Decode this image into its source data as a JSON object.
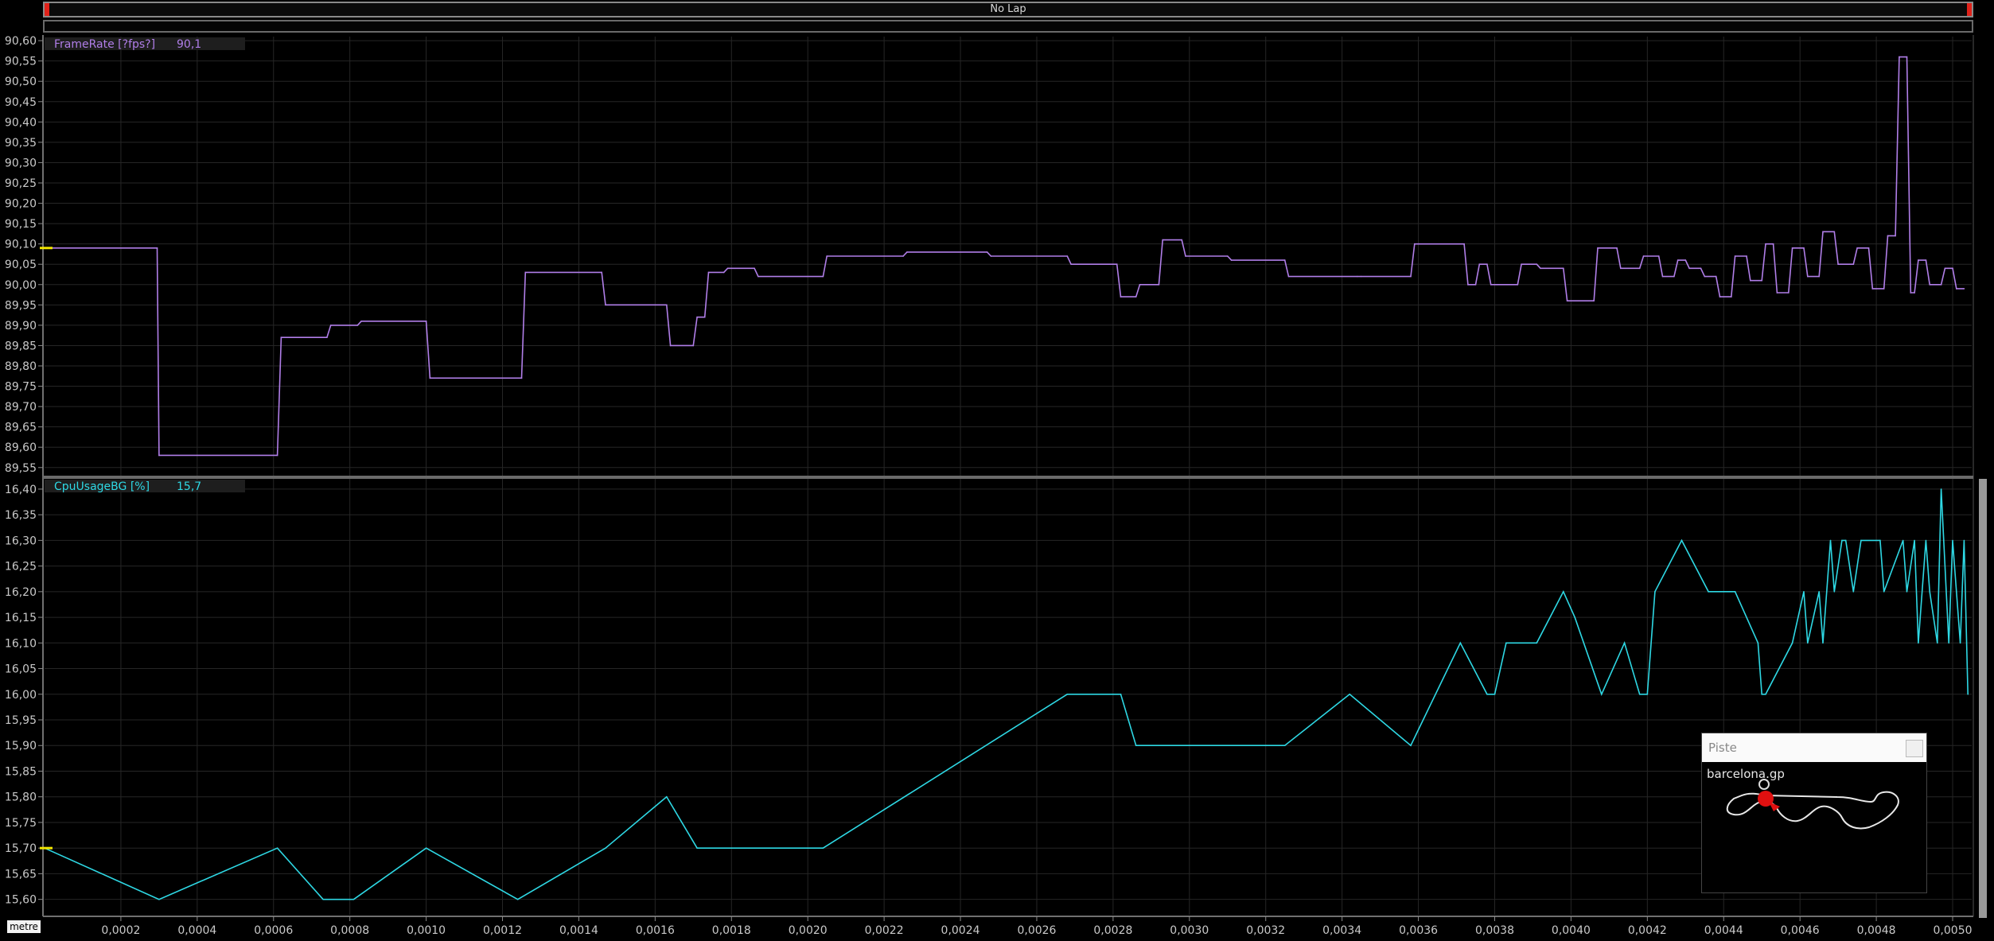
{
  "lap_bar": {
    "label": "No Lap"
  },
  "x_axis": {
    "unit": "metre",
    "range": [
      0,
      0.00505
    ],
    "ticks": [
      "0,0002",
      "0,0004",
      "0,0006",
      "0,0008",
      "0,0010",
      "0,0012",
      "0,0014",
      "0,0016",
      "0,0018",
      "0,0020",
      "0,0022",
      "0,0024",
      "0,0026",
      "0,0028",
      "0,0030",
      "0,0032",
      "0,0034",
      "0,0036",
      "0,0038",
      "0,0040",
      "0,0042",
      "0,0044",
      "0,0046",
      "0,0048",
      "0,0050"
    ]
  },
  "channels": [
    {
      "name": "FrameRate [?fps?]",
      "value": "90,1",
      "color": "#b07ee8",
      "y_ticks": [
        "90,60",
        "90,55",
        "90,50",
        "90,45",
        "90,40",
        "90,35",
        "90,30",
        "90,25",
        "90,20",
        "90,15",
        "90,10",
        "90,05",
        "90,00",
        "89,95",
        "89,90",
        "89,85",
        "89,80",
        "89,75",
        "89,70",
        "89,65",
        "89,60",
        "89,55"
      ]
    },
    {
      "name": "CpuUsageBG [%]",
      "value": "15,7",
      "color": "#2ed8e4",
      "y_ticks": [
        "16,40",
        "16,35",
        "16,30",
        "16,25",
        "16,20",
        "16,15",
        "16,10",
        "16,05",
        "16,00",
        "15,95",
        "15,90",
        "15,85",
        "15,80",
        "15,75",
        "15,70",
        "15,65",
        "15,60"
      ]
    }
  ],
  "chart_data": [
    {
      "type": "line",
      "series": [
        {
          "name": "FrameRate [?fps?]",
          "color": "#b07ee8",
          "x": [
            0,
            0.000295,
            0.0003,
            0.00061,
            0.00062,
            0.00074,
            0.00075,
            0.00082,
            0.00083,
            0.001,
            0.00101,
            0.00125,
            0.00126,
            0.00146,
            0.00147,
            0.00163,
            0.00164,
            0.0017,
            0.00171,
            0.00173,
            0.00174,
            0.00178,
            0.00179,
            0.00186,
            0.00187,
            0.00204,
            0.00205,
            0.00225,
            0.00226,
            0.00247,
            0.00248,
            0.00268,
            0.00269,
            0.00281,
            0.00282,
            0.00286,
            0.00287,
            0.00292,
            0.00293,
            0.00298,
            0.00299,
            0.0031,
            0.00311,
            0.00325,
            0.00326,
            0.00344,
            0.00345,
            0.00358,
            0.00359,
            0.00372,
            0.00373,
            0.00375,
            0.00376,
            0.00378,
            0.00379,
            0.00386,
            0.00387,
            0.00391,
            0.00392,
            0.00398,
            0.00399,
            0.00406,
            0.00407,
            0.00412,
            0.00413,
            0.00418,
            0.00419,
            0.00423,
            0.00424,
            0.00427,
            0.00428,
            0.0043,
            0.00431,
            0.00434,
            0.00435,
            0.00438,
            0.00439,
            0.00442,
            0.00443,
            0.00446,
            0.00447,
            0.0045,
            0.00451,
            0.00453,
            0.00454,
            0.00457,
            0.00458,
            0.00461,
            0.00462,
            0.00465,
            0.00466,
            0.00469,
            0.0047,
            0.00474,
            0.00475,
            0.00478,
            0.00479,
            0.00482,
            0.00483,
            0.00485,
            0.00486,
            0.00488,
            0.00489,
            0.0049,
            0.00491,
            0.00493,
            0.00494,
            0.00497,
            0.00498,
            0.005,
            0.00501,
            0.00503
          ],
          "values": [
            90.09,
            90.09,
            89.58,
            89.58,
            89.87,
            89.87,
            89.9,
            89.9,
            89.91,
            89.91,
            89.77,
            89.77,
            90.03,
            90.03,
            89.95,
            89.95,
            89.85,
            89.85,
            89.92,
            89.92,
            90.03,
            90.03,
            90.04,
            90.04,
            90.02,
            90.02,
            90.07,
            90.07,
            90.08,
            90.08,
            90.07,
            90.07,
            90.05,
            90.05,
            89.97,
            89.97,
            90.0,
            90.0,
            90.11,
            90.11,
            90.07,
            90.07,
            90.06,
            90.06,
            90.02,
            90.02,
            90.02,
            90.02,
            90.1,
            90.1,
            90.0,
            90.0,
            90.05,
            90.05,
            90.0,
            90.0,
            90.05,
            90.05,
            90.04,
            90.04,
            89.96,
            89.96,
            90.09,
            90.09,
            90.04,
            90.04,
            90.07,
            90.07,
            90.02,
            90.02,
            90.06,
            90.06,
            90.04,
            90.04,
            90.02,
            90.02,
            89.97,
            89.97,
            90.07,
            90.07,
            90.01,
            90.01,
            90.1,
            90.1,
            89.98,
            89.98,
            90.09,
            90.09,
            90.02,
            90.02,
            90.13,
            90.13,
            90.05,
            90.05,
            90.09,
            90.09,
            89.99,
            89.99,
            90.12,
            90.12,
            90.56,
            90.56,
            89.98,
            89.98,
            90.06,
            90.06,
            90.0,
            90.0,
            90.04,
            90.04,
            89.99,
            89.99
          ]
        }
      ],
      "xlim": [
        0,
        0.00505
      ],
      "ylim": [
        89.53,
        90.61
      ],
      "grid": true
    },
    {
      "type": "line",
      "series": [
        {
          "name": "CpuUsageBG [%]",
          "color": "#2ed8e4",
          "x": [
            0,
            0.0003,
            0.00061,
            0.00073,
            0.00081,
            0.001,
            0.00124,
            0.00147,
            0.00163,
            0.00171,
            0.00204,
            0.00268,
            0.00282,
            0.00286,
            0.00325,
            0.00342,
            0.00358,
            0.00371,
            0.00378,
            0.0038,
            0.00383,
            0.00391,
            0.00398,
            0.00401,
            0.00408,
            0.00414,
            0.00418,
            0.0042,
            0.00422,
            0.00429,
            0.00436,
            0.00443,
            0.00449,
            0.0045,
            0.00451,
            0.00458,
            0.00461,
            0.00462,
            0.00465,
            0.00466,
            0.00468,
            0.00469,
            0.00471,
            0.00472,
            0.00474,
            0.00476,
            0.00481,
            0.00482,
            0.00487,
            0.00488,
            0.0049,
            0.00491,
            0.00493,
            0.00494,
            0.00496,
            0.00497,
            0.00499,
            0.005,
            0.00502,
            0.00503,
            0.00504
          ],
          "values": [
            15.7,
            15.6,
            15.7,
            15.6,
            15.6,
            15.7,
            15.6,
            15.7,
            15.8,
            15.7,
            15.7,
            16.0,
            16.0,
            15.9,
            15.9,
            16.0,
            15.9,
            16.1,
            16.0,
            16.0,
            16.1,
            16.1,
            16.2,
            16.15,
            16.0,
            16.1,
            16.0,
            16.0,
            16.2,
            16.3,
            16.2,
            16.2,
            16.1,
            16.0,
            16.0,
            16.1,
            16.2,
            16.1,
            16.2,
            16.1,
            16.3,
            16.2,
            16.3,
            16.3,
            16.2,
            16.3,
            16.3,
            16.2,
            16.3,
            16.2,
            16.3,
            16.1,
            16.3,
            16.2,
            16.1,
            16.4,
            16.1,
            16.3,
            16.1,
            16.3,
            16.0
          ]
        }
      ],
      "xlim": [
        0,
        0.00505
      ],
      "ylim": [
        15.57,
        16.42
      ],
      "grid": true
    }
  ],
  "track_window": {
    "title": "Piste",
    "track_name": "barcelona.gp"
  }
}
